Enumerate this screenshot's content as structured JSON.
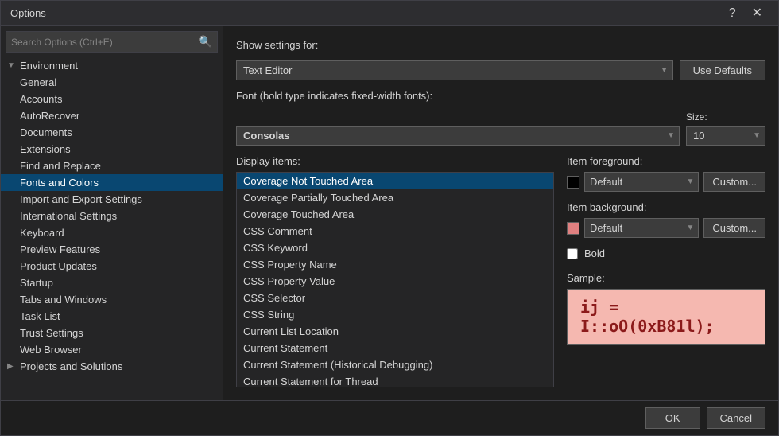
{
  "dialog": {
    "title": "Options",
    "help_button": "?",
    "close_button": "✕"
  },
  "search": {
    "placeholder": "Search Options (Ctrl+E)"
  },
  "tree": {
    "environment": {
      "label": "Environment",
      "expanded": true,
      "children": [
        {
          "label": "General",
          "selected": false
        },
        {
          "label": "Accounts",
          "selected": false
        },
        {
          "label": "AutoRecover",
          "selected": false
        },
        {
          "label": "Documents",
          "selected": false
        },
        {
          "label": "Extensions",
          "selected": false
        },
        {
          "label": "Find and Replace",
          "selected": false
        },
        {
          "label": "Fonts and Colors",
          "selected": true
        },
        {
          "label": "Import and Export Settings",
          "selected": false
        },
        {
          "label": "International Settings",
          "selected": false
        },
        {
          "label": "Keyboard",
          "selected": false
        },
        {
          "label": "Preview Features",
          "selected": false
        },
        {
          "label": "Product Updates",
          "selected": false
        },
        {
          "label": "Startup",
          "selected": false
        },
        {
          "label": "Tabs and Windows",
          "selected": false
        },
        {
          "label": "Task List",
          "selected": false
        },
        {
          "label": "Trust Settings",
          "selected": false
        },
        {
          "label": "Web Browser",
          "selected": false
        }
      ]
    },
    "projects_and_solutions": {
      "label": "Projects and Solutions",
      "expanded": false
    }
  },
  "settings": {
    "show_settings_label": "Show settings for:",
    "show_settings_value": "Text Editor",
    "use_defaults_label": "Use Defaults",
    "font_label": "Font (bold type indicates fixed-width fonts):",
    "font_value": "Consolas",
    "size_label": "Size:",
    "size_value": "10",
    "display_items_label": "Display items:",
    "display_items": [
      {
        "label": "Coverage Not Touched Area",
        "selected": true
      },
      {
        "label": "Coverage Partially Touched Area",
        "selected": false
      },
      {
        "label": "Coverage Touched Area",
        "selected": false
      },
      {
        "label": "CSS Comment",
        "selected": false
      },
      {
        "label": "CSS Keyword",
        "selected": false
      },
      {
        "label": "CSS Property Name",
        "selected": false
      },
      {
        "label": "CSS Property Value",
        "selected": false
      },
      {
        "label": "CSS Selector",
        "selected": false
      },
      {
        "label": "CSS String",
        "selected": false
      },
      {
        "label": "Current List Location",
        "selected": false
      },
      {
        "label": "Current Statement",
        "selected": false
      },
      {
        "label": "Current Statement (Historical Debugging)",
        "selected": false
      },
      {
        "label": "Current Statement for Thread",
        "selected": false
      }
    ],
    "item_foreground_label": "Item foreground:",
    "item_foreground_value": "Default",
    "item_foreground_swatch": "#000000",
    "custom_fg_label": "Custom...",
    "item_background_label": "Item background:",
    "item_background_value": "Default",
    "item_background_swatch": "#e08080",
    "custom_bg_label": "Custom...",
    "bold_label": "Bold",
    "sample_label": "Sample:",
    "sample_code": "ij = I::oO(0xB81l);"
  },
  "bottom": {
    "ok_label": "OK",
    "cancel_label": "Cancel"
  }
}
